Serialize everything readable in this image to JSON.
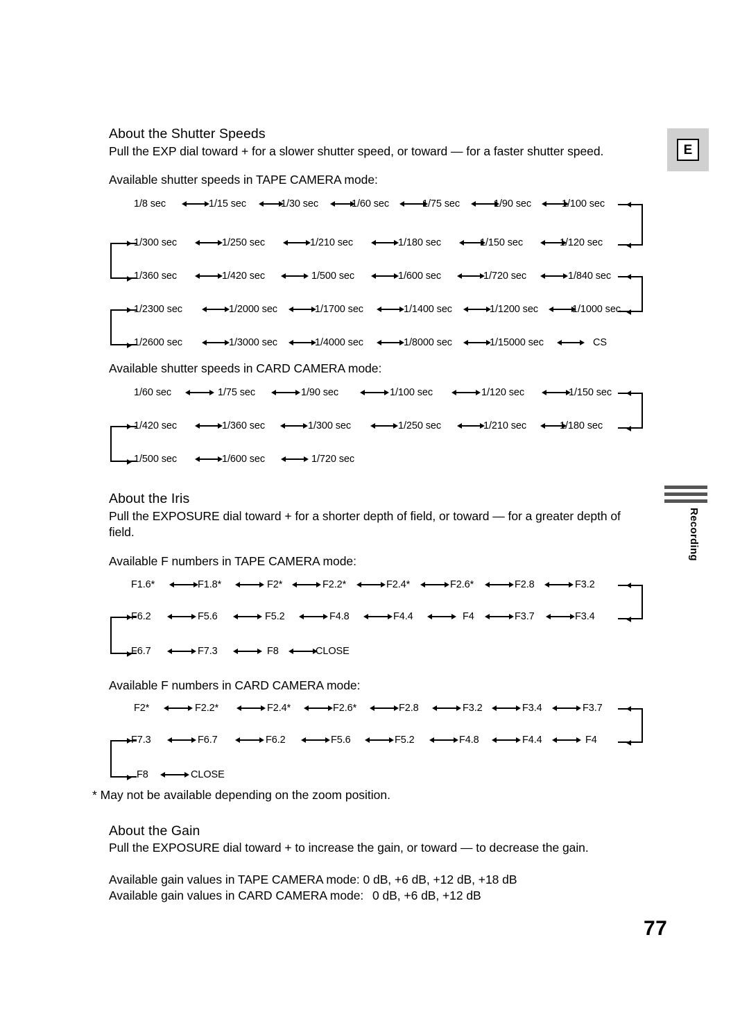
{
  "page": {
    "number": "77",
    "language_badge": "E",
    "side_tab_label": "Recording"
  },
  "sections": {
    "shutter": {
      "heading": "About the Shutter Speeds",
      "body": "Pull the EXP dial toward + for a slower shutter speed, or toward — for a faster shutter speed.",
      "tape_label": "Available shutter speeds in TAPE CAMERA mode:",
      "card_label": "Available shutter speeds in CARD CAMERA mode:",
      "tape_rows": [
        [
          "1/8 sec",
          "1/15 sec",
          "1/30 sec",
          "1/60 sec",
          "1/75 sec",
          "1/90 sec",
          "1/100 sec"
        ],
        [
          "1/300 sec",
          "1/250 sec",
          "1/210 sec",
          "1/180 sec",
          "1/150 sec",
          "1/120 sec"
        ],
        [
          "1/360 sec",
          "1/420 sec",
          "1/500 sec",
          "1/600 sec",
          "1/720 sec",
          "1/840 sec"
        ],
        [
          "1/2300 sec",
          "1/2000 sec",
          "1/1700 sec",
          "1/1400 sec",
          "1/1200 sec",
          "1/1000 sec"
        ],
        [
          "1/2600 sec",
          "1/3000 sec",
          "1/4000 sec",
          "1/8000 sec",
          "1/15000 sec",
          "CS"
        ]
      ],
      "card_rows": [
        [
          "1/60 sec",
          "1/75 sec",
          "1/90 sec",
          "1/100 sec",
          "1/120 sec",
          "1/150 sec"
        ],
        [
          "1/420 sec",
          "1/360 sec",
          "1/300 sec",
          "1/250 sec",
          "1/210 sec",
          "1/180 sec"
        ],
        [
          "1/500 sec",
          "1/600 sec",
          "1/720 sec"
        ]
      ]
    },
    "iris": {
      "heading": "About the Iris",
      "body_line1": "Pull the EXPOSURE dial toward + for a shorter depth of field, or toward — for a greater depth of",
      "body_line2": "field.",
      "tape_label": "Available F numbers in TAPE CAMERA mode:",
      "card_label": "Available F numbers in CARD CAMERA mode:",
      "tape_rows": [
        [
          "F1.6*",
          "F1.8*",
          "F2*",
          "F2.2*",
          "F2.4*",
          "F2.6*",
          "F2.8",
          "F3.2"
        ],
        [
          "F6.2",
          "F5.6",
          "F5.2",
          "F4.8",
          "F4.4",
          "F4",
          "F3.7",
          "F3.4"
        ],
        [
          "F6.7",
          "F7.3",
          "F8",
          "CLOSE"
        ]
      ],
      "card_rows": [
        [
          "F2*",
          "F2.2*",
          "F2.4*",
          "F2.6*",
          "F2.8",
          "F3.2",
          "F3.4",
          "F3.7"
        ],
        [
          "F7.3",
          "F6.7",
          "F6.2",
          "F5.6",
          "F5.2",
          "F4.8",
          "F4.4",
          "F4"
        ],
        [
          "F8",
          "CLOSE"
        ]
      ],
      "footnote": "* May not be available depending on the zoom position."
    },
    "gain": {
      "heading": "About the Gain",
      "body": "Pull the EXPOSURE dial toward + to increase the gain, or toward — to decrease the gain.",
      "tape_line": "Available gain values in TAPE CAMERA mode: 0 dB, +6 dB, +12 dB, +18 dB",
      "card_line_a": "Available gain values in CARD CAMERA mode:",
      "card_line_b": "0 dB, +6 dB, +12 dB"
    }
  }
}
